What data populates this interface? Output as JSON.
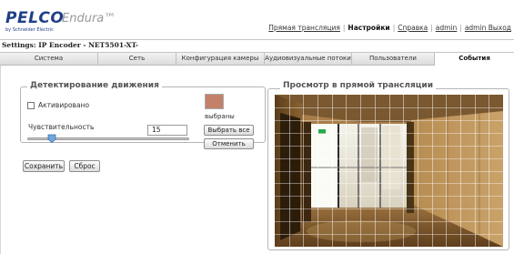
{
  "header": {
    "brand": "PELCO",
    "product": "Endura™",
    "sub_brand": "by Schneider Electric",
    "nav": [
      {
        "label": "Прямая трансляция",
        "active": false
      },
      {
        "label": "Настройки",
        "active": true
      },
      {
        "label": "Справка",
        "active": false
      },
      {
        "label": "admin",
        "active": false
      },
      {
        "label": "admin Выход",
        "active": false
      }
    ]
  },
  "settings_title": "Settings: IP Encoder - NET5501-XT-",
  "tabs": [
    {
      "label": "Система",
      "active": false
    },
    {
      "label": "Сеть",
      "active": false
    },
    {
      "label": "Конфигурация камеры",
      "active": false
    },
    {
      "label": "Аудиовизуальные потоки",
      "active": false
    },
    {
      "label": "Пользователи",
      "active": false
    },
    {
      "label": "События",
      "active": true
    }
  ],
  "motion": {
    "legend": "Детектирование движения",
    "enabled_label": "Активировано",
    "enabled": false,
    "sensitivity_label": "Чувствительность",
    "sensitivity_value": "15",
    "sensitivity_fraction": 0.15,
    "swatch_color": "#c4816a",
    "selected_label": "выбраны",
    "select_all_label": "Выбрать все",
    "cancel_label": "Отменить"
  },
  "actions": {
    "save_label": "Сохранить",
    "reset_label": "Сброс"
  },
  "live": {
    "legend": "Просмотр в прямой трансляции",
    "grid_columns": 16,
    "grid_rows": 12
  }
}
